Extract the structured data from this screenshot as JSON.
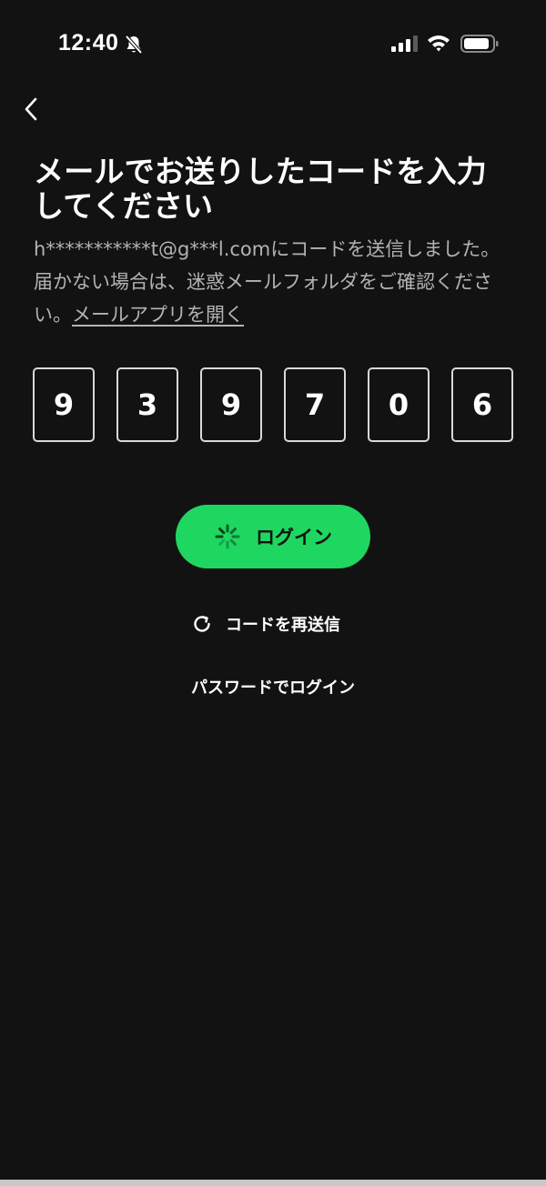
{
  "status_bar": {
    "time": "12:40",
    "icons": [
      "bell-slash-icon",
      "cellular-signal-icon",
      "wifi-icon",
      "battery-icon"
    ]
  },
  "nav": {
    "back_icon": "chevron-left-icon"
  },
  "page": {
    "title": "メールでお送りしたコードを入力してください",
    "description": "h***********t@g***l.comにコードを送信しました。届かない場合は、迷惑メールフォルダをご確認ください。",
    "open_mail_link": "メールアプリを開く"
  },
  "code": {
    "digits": [
      "9",
      "3",
      "9",
      "7",
      "0",
      "6"
    ]
  },
  "actions": {
    "login_label": "ログイン",
    "login_icon": "loading-spinner-icon",
    "resend_label": "コードを再送信",
    "resend_icon": "refresh-icon",
    "password_login_label": "パスワードでログイン"
  },
  "colors": {
    "background": "#121212",
    "accent": "#1ed760",
    "text_primary": "#ffffff",
    "text_secondary": "#b3b3b3"
  }
}
